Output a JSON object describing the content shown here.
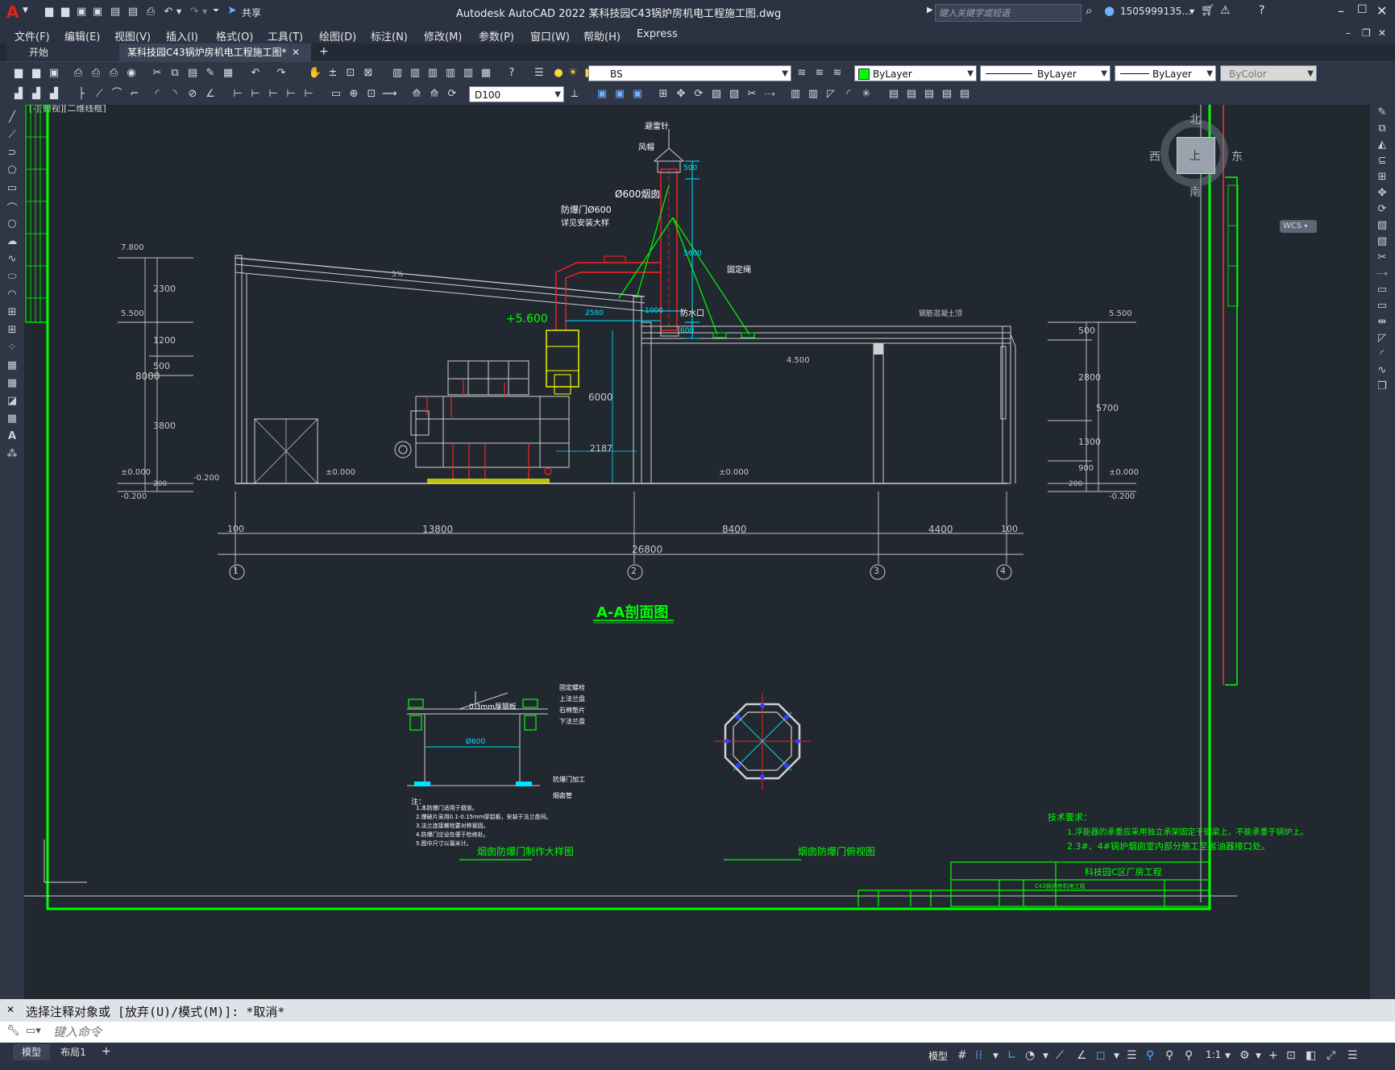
{
  "app": {
    "logo": "A",
    "title": "Autodesk AutoCAD 2022    某科技园C43锅炉房机电工程施工图.dwg",
    "share_label": "共享",
    "search_placeholder": "键入关键字或短语",
    "user": "1505999135...",
    "window_controls": [
      "minimize-icon",
      "maximize-icon",
      "close-icon"
    ]
  },
  "menu": [
    "文件(F)",
    "编辑(E)",
    "视图(V)",
    "插入(I)",
    "格式(O)",
    "工具(T)",
    "绘图(D)",
    "标注(N)",
    "修改(M)",
    "参数(P)",
    "窗口(W)",
    "帮助(H)",
    "Express"
  ],
  "tabs": [
    {
      "label": "开始",
      "active": false
    },
    {
      "label": "某科技园C43锅炉房机电工程施工图*",
      "active": true
    }
  ],
  "toolbar": {
    "layer": "BS",
    "color": "ByLayer",
    "linetype": "ByLayer",
    "lineweight": "ByLayer",
    "plotstyle": "ByColor",
    "dimstyle": "D100"
  },
  "viewcube": {
    "north": "北",
    "south": "南",
    "east": "东",
    "west": "西",
    "face": "上",
    "wcs": "WCS"
  },
  "drawing": {
    "corner_label": "[-][俯视][二维线框]",
    "section_title": "A-A剖面图",
    "detail1_title": "烟囱防爆门制作大样图",
    "detail2_title": "烟囱防爆门俯视图",
    "notes_title": "技术要求：",
    "note1": "1.浮能器的承重应采用独立承架固定于钢梁上，不能承重于锅炉上。",
    "note2": "2.3#、4#锅炉烟囱室内部分施工至省油器接口处。",
    "title_block_project": "科技园C区厂房工程",
    "title_block_drawing": "C43锅炉房机电工程",
    "labels": {
      "rain_cap": "避雷针",
      "hood": "风帽",
      "flue": "Ø600烟囱",
      "explosion_door": "防爆门Ø600",
      "install_ref": "详见安装大样",
      "guy": "固定绳",
      "reinforced": "钢筋混凝土顶",
      "air_door": "防水口",
      "level_5600": "+5.600",
      "door_dim": "0.3mm厚钢板",
      "phi600": "Ø600",
      "fix_bolt": "固定螺栓",
      "upper_flange": "上法兰盘",
      "gasket": "石棉垫片",
      "lower_flange": "下法兰盘",
      "door_note": "防爆门加工",
      "flue_pipe": "烟囱管",
      "notes_head": "注："
    },
    "note_lines": [
      "1.本防爆门适用于烟道。",
      "2.爆破片采用0.1-0.15mm厚铝板，安装于法兰盘间。",
      "3.法兰连接螺栓要对称紧固。",
      "4.防爆门应设在便于检修处。",
      "5.图中尺寸以毫米计。"
    ],
    "dims": {
      "d_13800": "13800",
      "d_8400": "8400",
      "d_4400": "4400",
      "d_26800": "26800",
      "d_100a": "100",
      "d_100b": "100",
      "d_2580": "2580",
      "d_1000": "1000",
      "d_500top": "500",
      "d_5600": "5600",
      "d_600": "600",
      "d_6000": "6000",
      "d_2187": "2187",
      "d_8000": "8000",
      "d_2300": "2300",
      "d_1200": "1200",
      "d_500l": "500",
      "d_3800": "3800",
      "d_200l": "200",
      "d_500r": "500",
      "d_2800": "2800",
      "d_5700": "5700",
      "d_1300": "1300",
      "d_900": "900",
      "d_200r": "200",
      "slope": "5%"
    },
    "levels": {
      "l7800": "7.800",
      "l5500": "5.500",
      "l0a": "±0.000",
      "lm200a": "-0.200",
      "lm200b": "-0.200",
      "l0b": "±0.000",
      "l4500": "4.500",
      "l0c": "±0.000",
      "l5500r": "5.500",
      "l0d": "±0.000",
      "lm200c": "-0.200"
    },
    "grid_axes": [
      "1",
      "2",
      "3",
      "4"
    ]
  },
  "command": {
    "history": "选择注释对象或 [放弃(U)/模式(M)]: *取消*",
    "placeholder": "键入命令"
  },
  "status": {
    "tab_model": "模型",
    "tab_layout": "布局1",
    "model_button": "模型",
    "scale": "1:1"
  },
  "colors": {
    "accent_green": "#00ff00",
    "cyan": "#00e5ff",
    "red": "#ff2020",
    "yellow": "#ffff00",
    "canvas": "#212830"
  }
}
